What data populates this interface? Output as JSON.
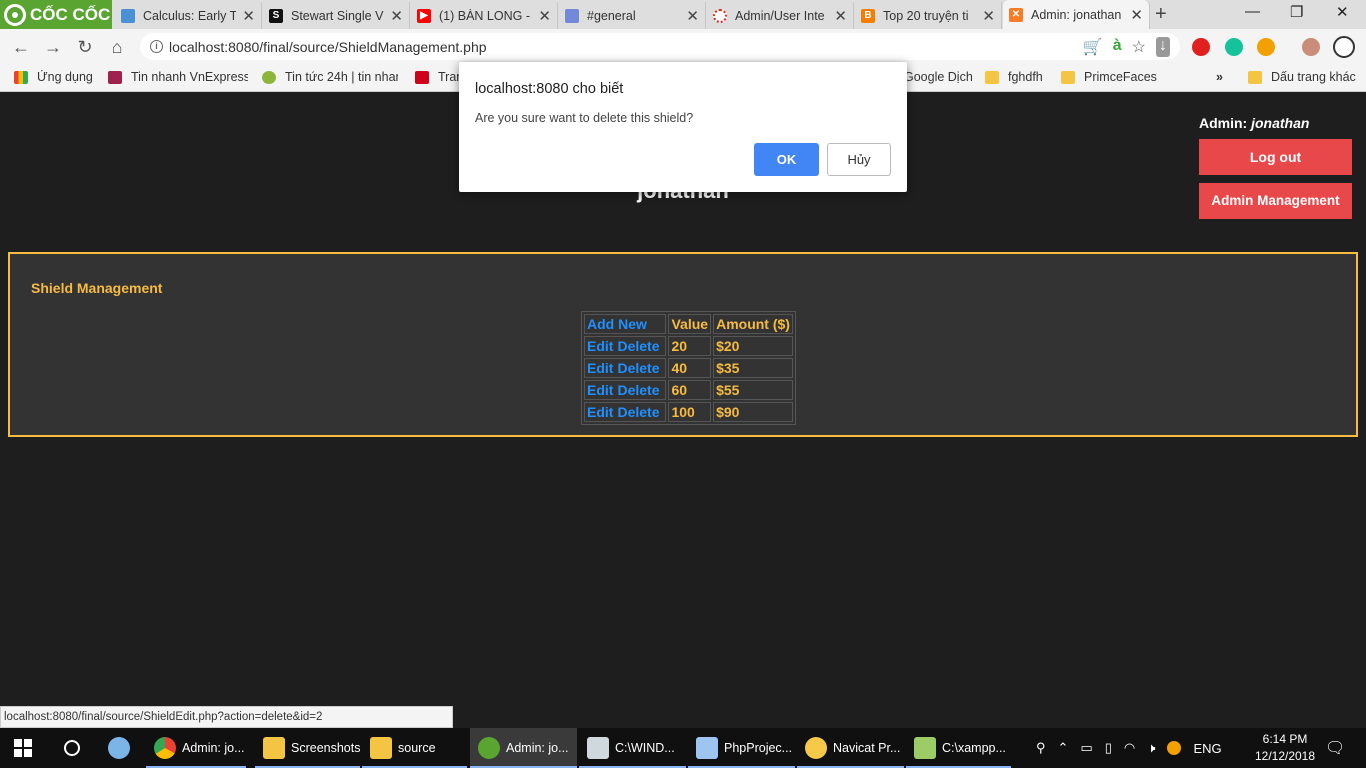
{
  "browser": {
    "brand": "CỐC CỐC",
    "tabs": [
      {
        "label": "Calculus: Early Tr",
        "icon": "book-icon",
        "color": "#4a90d9"
      },
      {
        "label": "Stewart Single V",
        "icon": "s-icon",
        "color": "#111111"
      },
      {
        "label": "(1) BÀN LONG - ",
        "icon": "youtube-icon",
        "color": "#ff0000"
      },
      {
        "label": "#general",
        "icon": "discord-icon",
        "color": "#7289da"
      },
      {
        "label": "Admin/User Inte",
        "icon": "spinner-icon",
        "color": "#d93025"
      },
      {
        "label": "Top 20 truyện ti",
        "icon": "blogger-icon",
        "color": "#f57d00"
      },
      {
        "label": "Admin: jonathan",
        "icon": "xampp-icon",
        "color": "#fb7a24"
      }
    ],
    "url": "localhost:8080/final/source/ShieldManagement.php",
    "bookmarks": [
      {
        "label": "Ứng dụng",
        "icon": "apps-icon"
      },
      {
        "label": "Tin nhanh VnExpress",
        "icon": "vnexpress-icon"
      },
      {
        "label": "Tin tức 24h | tin nhan",
        "icon": "24h-icon"
      },
      {
        "label": "Tran",
        "icon": "gk-icon"
      },
      {
        "label": "Google Dịch",
        "icon": "translate-icon"
      },
      {
        "label": "fghdfh",
        "icon": "folder-icon"
      },
      {
        "label": "PrimceFaces",
        "icon": "folder-icon"
      },
      {
        "label": "»",
        "icon": ""
      },
      {
        "label": "Dấu trang khác",
        "icon": "folder-icon"
      }
    ]
  },
  "page": {
    "admin_prefix": "Admin:",
    "admin_name": "jonathan",
    "logout_label": "Log out",
    "admin_mgmt_label": "Admin Management",
    "welcome_name": "jonathan",
    "panel_title": "Shield Management",
    "table": {
      "add_new": "Add New",
      "headers": [
        "Value",
        "Amount ($)"
      ],
      "edit_label": "Edit",
      "delete_label": "Delete",
      "rows": [
        {
          "value": "20",
          "amount": "$20"
        },
        {
          "value": "40",
          "amount": "$35"
        },
        {
          "value": "60",
          "amount": "$55"
        },
        {
          "value": "100",
          "amount": "$90"
        }
      ]
    }
  },
  "dialog": {
    "title": "localhost:8080 cho biết",
    "message": "Are you sure want to delete this shield?",
    "ok_label": "OK",
    "cancel_label": "Hủy"
  },
  "status_url": "localhost:8080/final/source/ShieldEdit.php?action=delete&id=2",
  "taskbar": {
    "items": [
      {
        "label": "Admin: jo...",
        "icon": "chrome-icon"
      },
      {
        "label": "Screenshots",
        "icon": "folder-icon"
      },
      {
        "label": "source",
        "icon": "folder-icon"
      },
      {
        "label": "Admin: jo...",
        "icon": "coccoc-icon"
      },
      {
        "label": "C:\\WIND...",
        "icon": "cmd-icon"
      },
      {
        "label": "PhpProjec...",
        "icon": "php-icon"
      },
      {
        "label": "Navicat Pr...",
        "icon": "navicat-icon"
      },
      {
        "label": "C:\\xampp...",
        "icon": "notepad-icon"
      }
    ],
    "language": "ENG",
    "time": "6:14 PM",
    "date": "12/12/2018"
  },
  "colors": {
    "accent": "#f7bb3f",
    "link": "#1e90ff",
    "button_red": "#e9484a",
    "dialog_ok": "#4285f4"
  }
}
